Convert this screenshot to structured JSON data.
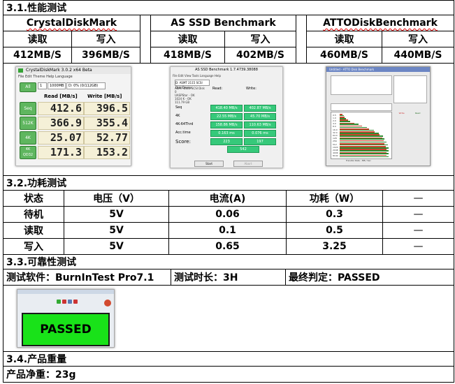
{
  "perf": {
    "heading": "3.1.性能测试",
    "tools": [
      "CrystalDiskMark",
      "AS SSD Benchmark",
      "ATTODiskBenchmark"
    ],
    "read_label": "读取",
    "write_label": "写入",
    "results": [
      {
        "read": "412MB/S",
        "write": "396MB/S"
      },
      {
        "read": "418MB/S",
        "write": "402MB/S"
      },
      {
        "read": "460MB/S",
        "write": "440MB/S"
      }
    ]
  },
  "cdm_shot": {
    "title": "CrystalDiskMark 3.0.2 x64 Beta",
    "menu": "File  Edit  Theme  Help  Language",
    "runs": "1",
    "size": "1000MB",
    "drive": "D: 0% (0/112GB)",
    "read_header": "Read [MB/s]",
    "write_header": "Write [MB/s]",
    "all_label": "All",
    "rows": [
      {
        "label": "Seq",
        "read": "412.6",
        "write": "396.5"
      },
      {
        "label": "512K",
        "read": "366.9",
        "write": "355.4"
      },
      {
        "label": "4K",
        "read": "25.07",
        "write": "52.77"
      },
      {
        "label": "4K QD32",
        "read": "171.3",
        "write": "153.2"
      }
    ]
  },
  "as_shot": {
    "title": "AS SSD Benchmark 1.7.4739.38088",
    "menu": "File  Edit  View  Tools  Language  Help",
    "drive": "D: ASMT 2115 SCSI Disk Device",
    "info": [
      "ASMT 2115 SCSI Disk",
      "0",
      "UASPStor - OK",
      "1024 K - OK",
      "111.79 GB"
    ],
    "read_header": "Read:",
    "write_header": "Write:",
    "rows": [
      {
        "label": "Seq",
        "read": "418.40 MB/s",
        "write": "402.87 MB/s"
      },
      {
        "label": "4K",
        "read": "22.55 MB/s",
        "write": "45.70 MB/s"
      },
      {
        "label": "4K-64Thrd",
        "read": "158.86 MB/s",
        "write": "110.63 MB/s"
      },
      {
        "label": "Acc.time",
        "read": "0.163 ms",
        "write": "0.076 ms"
      }
    ],
    "score_label": "Score:",
    "score_read": "223",
    "score_write": "197",
    "score_total": "542",
    "start": "Start",
    "abort": "Abort"
  },
  "atto_shot": {
    "title": "Untitled - ATTO Disk Benchmark",
    "footer": "Transfer Rate - MB / Sec",
    "legend_write": "Write",
    "legend_read": "Read",
    "chart_data": {
      "type": "bar",
      "categories": [
        "0.5",
        "1.0",
        "2.0",
        "4.0",
        "8.0",
        "16.0",
        "32.0",
        "64.0",
        "128",
        "256",
        "512",
        "1024",
        "2048",
        "4096",
        "8192"
      ],
      "series": [
        {
          "name": "Write",
          "values": [
            0.06,
            0.1,
            0.17,
            0.3,
            0.45,
            0.6,
            0.72,
            0.82,
            0.87,
            0.9,
            0.92,
            0.94,
            0.95,
            0.95,
            0.95
          ]
        },
        {
          "name": "Read",
          "values": [
            0.08,
            0.13,
            0.22,
            0.38,
            0.55,
            0.7,
            0.8,
            0.88,
            0.92,
            0.96,
            0.98,
            1.0,
            1.0,
            1.0,
            1.0
          ]
        }
      ],
      "xlim": [
        0,
        1
      ]
    }
  },
  "power": {
    "heading": "3.2.功耗测试",
    "headers": [
      "状态",
      "电压（V）",
      "电流(A)",
      "功耗（W）",
      "—"
    ],
    "rows": [
      {
        "state": "待机",
        "voltage": "5V",
        "current": "0.06",
        "power": "0.3",
        "note": "—"
      },
      {
        "state": "读取",
        "voltage": "5V",
        "current": "0.1",
        "power": "0.5",
        "note": "—"
      },
      {
        "state": "写入",
        "voltage": "5V",
        "current": "0.65",
        "power": "3.25",
        "note": "—"
      }
    ]
  },
  "reliability": {
    "heading": "3.3.可靠性测试",
    "software": "测试软件：BurnInTest Pro7.1",
    "duration": "测试时长：3H",
    "verdict": "最终判定：PASSED",
    "passed_banner": "PASSED"
  },
  "weight": {
    "heading": "3.4.产品重量",
    "net": "产品净重：23g"
  }
}
